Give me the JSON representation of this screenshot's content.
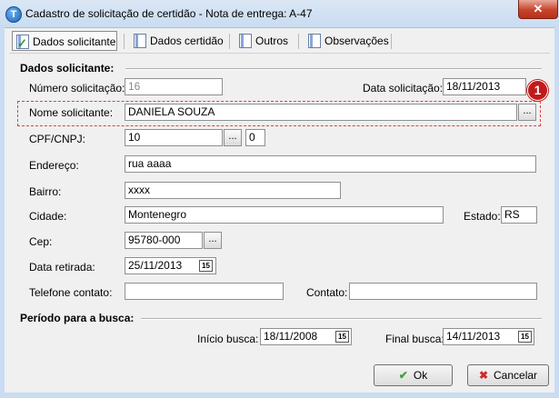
{
  "window": {
    "title": "Cadastro de solicitação de certidão - Nota de entrega: A-47",
    "close_glyph": "✕"
  },
  "tabs": [
    {
      "label": "Dados solicitante",
      "active": true
    },
    {
      "label": "Dados certidão"
    },
    {
      "label": "Outros"
    },
    {
      "label": "Observações"
    }
  ],
  "section_solicitante": {
    "title": "Dados solicitante:",
    "numero_label": "Número solicitação:",
    "numero_value": "16",
    "data_label": "Data solicitação:",
    "data_value": "18/11/2013",
    "nome_label": "Nome solicitante:",
    "nome_value": "DANIELA SOUZA",
    "cpf_label": "CPF/CNPJ:",
    "cpf_value": "10",
    "cpf_digit": "0",
    "endereco_label": "Endereço:",
    "endereco_value": "rua aaaa",
    "bairro_label": "Bairro:",
    "bairro_value": "xxxx",
    "cidade_label": "Cidade:",
    "cidade_value": "Montenegro",
    "estado_label": "Estado:",
    "estado_value": "RS",
    "cep_label": "Cep:",
    "cep_value": "95780-000",
    "retirada_label": "Data retirada:",
    "retirada_value": "25/11/2013",
    "telefone_label": "Telefone contato:",
    "telefone_value": "",
    "contato_label": "Contato:",
    "contato_value": ""
  },
  "annotation": {
    "badge": "1"
  },
  "section_periodo": {
    "title": "Período para a busca:",
    "inicio_label": "Início busca:",
    "inicio_value": "18/11/2008",
    "final_label": "Final busca:",
    "final_value": "14/11/2013"
  },
  "buttons": {
    "ok_label": "Ok",
    "cancel_label": "Cancelar",
    "dots_label": "...",
    "cal_label": "15"
  },
  "colors": {
    "highlight": "#e04040",
    "badge": "#c31a1a",
    "ok": "#3aa533",
    "cancel": "#d02b2b"
  }
}
